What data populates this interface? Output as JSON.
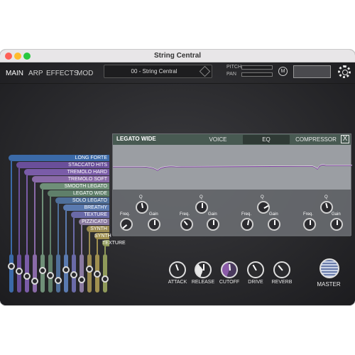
{
  "window": {
    "title": "String Central"
  },
  "nav": [
    "MAIN",
    "ARP",
    "EFFECTS",
    "MOD"
  ],
  "preset": {
    "name": "00 - String Central"
  },
  "sliders": {
    "pitch": "PITCH",
    "pan": "PAN"
  },
  "mod_button": "M",
  "panel": {
    "title": "LEGATO WIDE",
    "tabs": [
      "VOICE",
      "EQ",
      "COMPRESSOR"
    ],
    "close": "X",
    "bands": [
      {
        "q": "Q",
        "freq": "Freq.",
        "gain": "Gain"
      },
      {
        "q": "Q",
        "freq": "Freq.",
        "gain": "Gain"
      },
      {
        "q": "Q",
        "freq": "Freq.",
        "gain": "Gain"
      },
      {
        "q": "Q",
        "freq": "Freq.",
        "gain": "Gain"
      }
    ]
  },
  "layers": [
    "LONG FORTE",
    "STACCATO HITS",
    "TREMOLO HARD",
    "TREMOLO SOFT",
    "SMOOTH LEGATO",
    "LEGATO WIDE",
    "SOLO LEGATO",
    "BREATHY",
    "TEXTURE SWELL",
    "PIZZICATO",
    "SYNTH 1",
    "SYNTH 2",
    "TEXTURE"
  ],
  "layer_colors": [
    "#3b6aa8",
    "#6a4f9a",
    "#7a5ca8",
    "#8a6aa8",
    "#6f8f78",
    "#5f7f6a",
    "#4f6f9a",
    "#5a7ab0",
    "#6a6aa8",
    "#8a7aa0",
    "#9a8a50",
    "#a09050",
    "#8f9a5a"
  ],
  "macros": [
    "ATTACK",
    "RELEASE",
    "CUTOFF",
    "DRIVE",
    "REVERB"
  ],
  "master_label": "MASTER"
}
